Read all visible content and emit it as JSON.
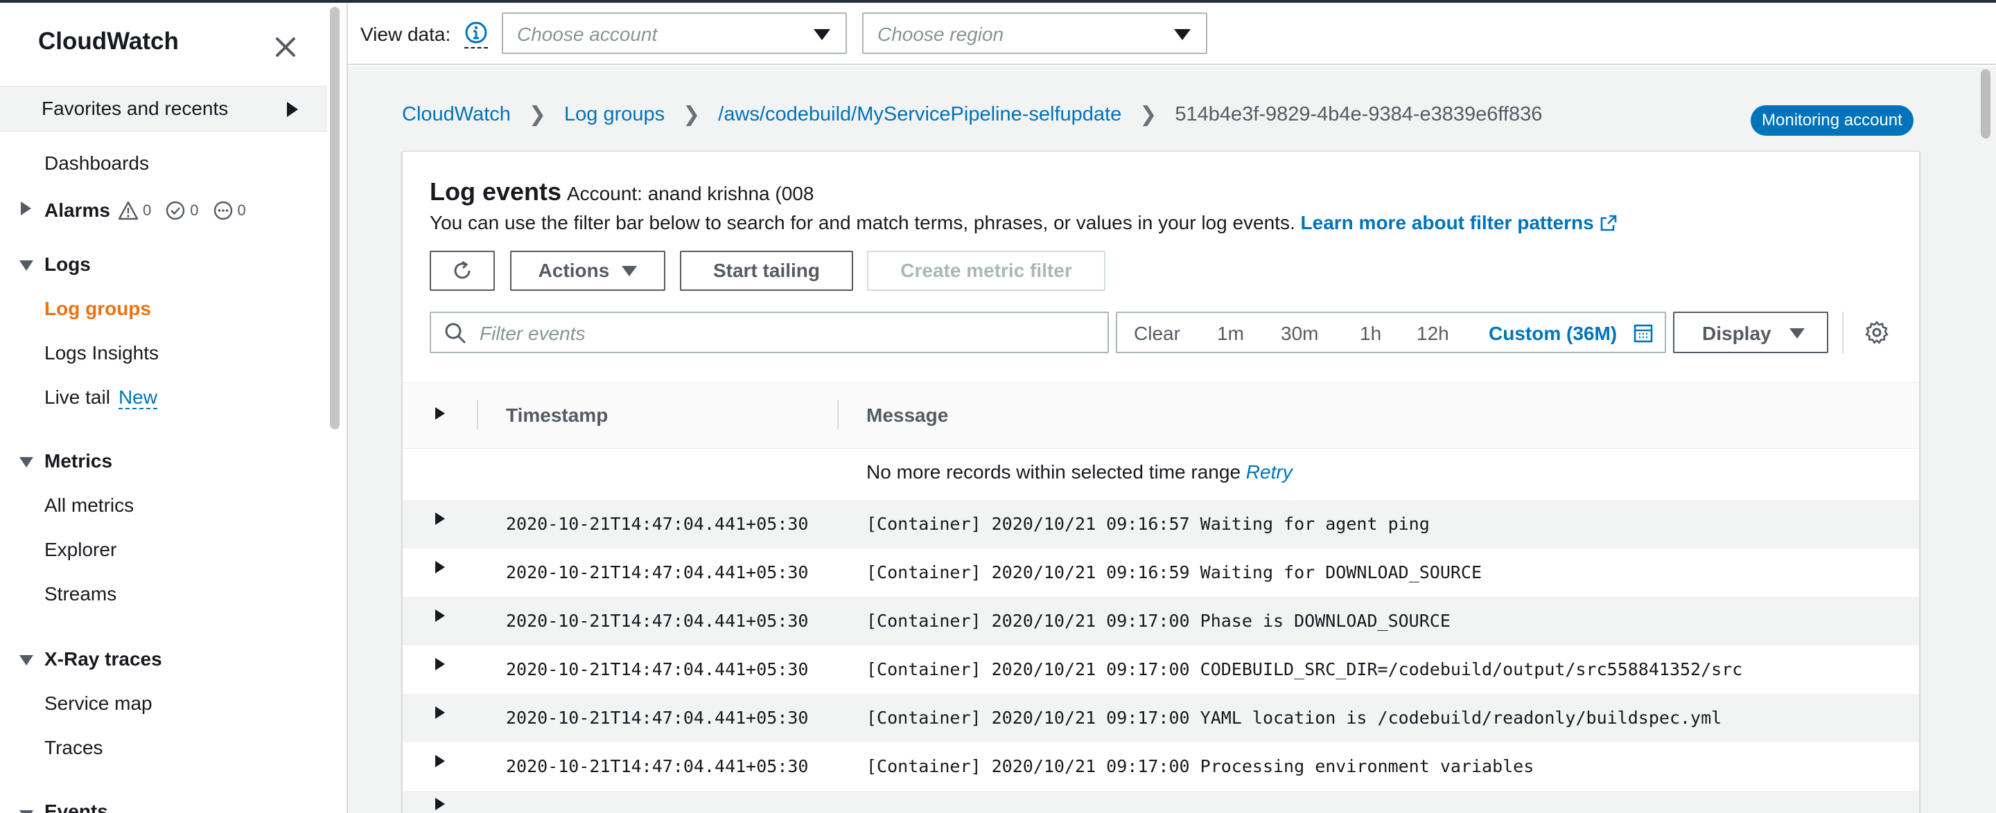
{
  "sidebar": {
    "title": "CloudWatch",
    "favorites_label": "Favorites and recents",
    "dashboards": "Dashboards",
    "alarms": {
      "label": "Alarms",
      "in_alarm": "0",
      "ok": "0",
      "insufficient": "0"
    },
    "logs": {
      "label": "Logs",
      "items": [
        "Log groups",
        "Logs Insights",
        "Live tail"
      ],
      "live_tail_badge": "New",
      "active": "Log groups"
    },
    "metrics": {
      "label": "Metrics",
      "items": [
        "All metrics",
        "Explorer",
        "Streams"
      ]
    },
    "xray": {
      "label": "X-Ray traces",
      "items": [
        "Service map",
        "Traces"
      ]
    },
    "events_label": "Events"
  },
  "topbar": {
    "view_data_label": "View data:",
    "account_placeholder": "Choose account",
    "region_placeholder": "Choose region"
  },
  "breadcrumb": {
    "items": [
      "CloudWatch",
      "Log groups",
      "/aws/codebuild/MyServicePipeline-selfupdate"
    ],
    "current": "514b4e3f-9829-4b4e-9384-e3839e6ff836"
  },
  "badge": "Monitoring account",
  "panel": {
    "title": "Log events",
    "account": "Account: anand krishna (008",
    "description": "You can use the filter bar below to search for and match terms, phrases, or values in your log events.",
    "learn_more": "Learn more about filter patterns",
    "buttons": {
      "actions": "Actions",
      "start_tailing": "Start tailing",
      "create_metric_filter": "Create metric filter"
    },
    "filter_placeholder": "Filter events",
    "time_range": {
      "clear": "Clear",
      "options": [
        "1m",
        "30m",
        "1h",
        "12h"
      ],
      "custom": "Custom (36M)"
    },
    "display": "Display"
  },
  "table": {
    "columns": [
      "Timestamp",
      "Message"
    ],
    "no_more_text": "No more records within selected time range",
    "retry": "Retry",
    "rows": [
      {
        "timestamp": "2020-10-21T14:47:04.441+05:30",
        "message": "[Container] 2020/10/21 09:16:57 Waiting for agent ping"
      },
      {
        "timestamp": "2020-10-21T14:47:04.441+05:30",
        "message": "[Container] 2020/10/21 09:16:59 Waiting for DOWNLOAD_SOURCE"
      },
      {
        "timestamp": "2020-10-21T14:47:04.441+05:30",
        "message": "[Container] 2020/10/21 09:17:00 Phase is DOWNLOAD_SOURCE"
      },
      {
        "timestamp": "2020-10-21T14:47:04.441+05:30",
        "message": "[Container] 2020/10/21 09:17:00 CODEBUILD_SRC_DIR=/codebuild/output/src558841352/src"
      },
      {
        "timestamp": "2020-10-21T14:47:04.441+05:30",
        "message": "[Container] 2020/10/21 09:17:00 YAML location is /codebuild/readonly/buildspec.yml"
      },
      {
        "timestamp": "2020-10-21T14:47:04.441+05:30",
        "message": "[Container] 2020/10/21 09:17:00 Processing environment variables"
      }
    ]
  },
  "colors": {
    "link": "#0073bb",
    "active_nav": "#ec7211",
    "badge_bg": "#0073bb"
  }
}
